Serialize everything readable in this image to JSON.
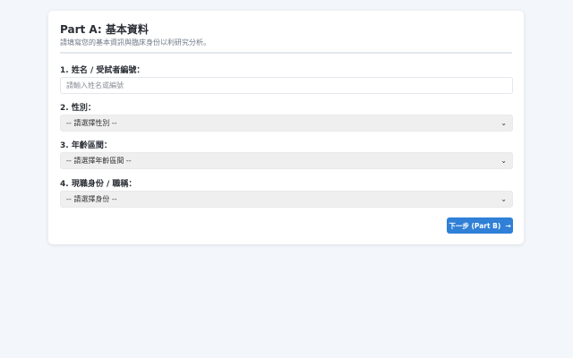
{
  "form": {
    "title": "Part A: 基本資料",
    "subtitle": "請填寫您的基本資訊與臨床身份以利研究分析。",
    "fields": [
      {
        "label": "1. 姓名 / 受試者編號：",
        "placeholder": "請輸入姓名或編號",
        "value": ""
      },
      {
        "label": "2. 性別：",
        "selected": "-- 請選擇性別 --"
      },
      {
        "label": "3. 年齡區間：",
        "selected": "-- 請選擇年齡區間 --"
      },
      {
        "label": "4. 現職身份 / 職稱：",
        "selected": "-- 請選擇身份 --"
      }
    ],
    "next_button": "下一步 (Part B)",
    "next_arrow": "→"
  },
  "colors": {
    "accent": "#2f80d6",
    "background": "#f3f6fa",
    "card": "#ffffff"
  }
}
